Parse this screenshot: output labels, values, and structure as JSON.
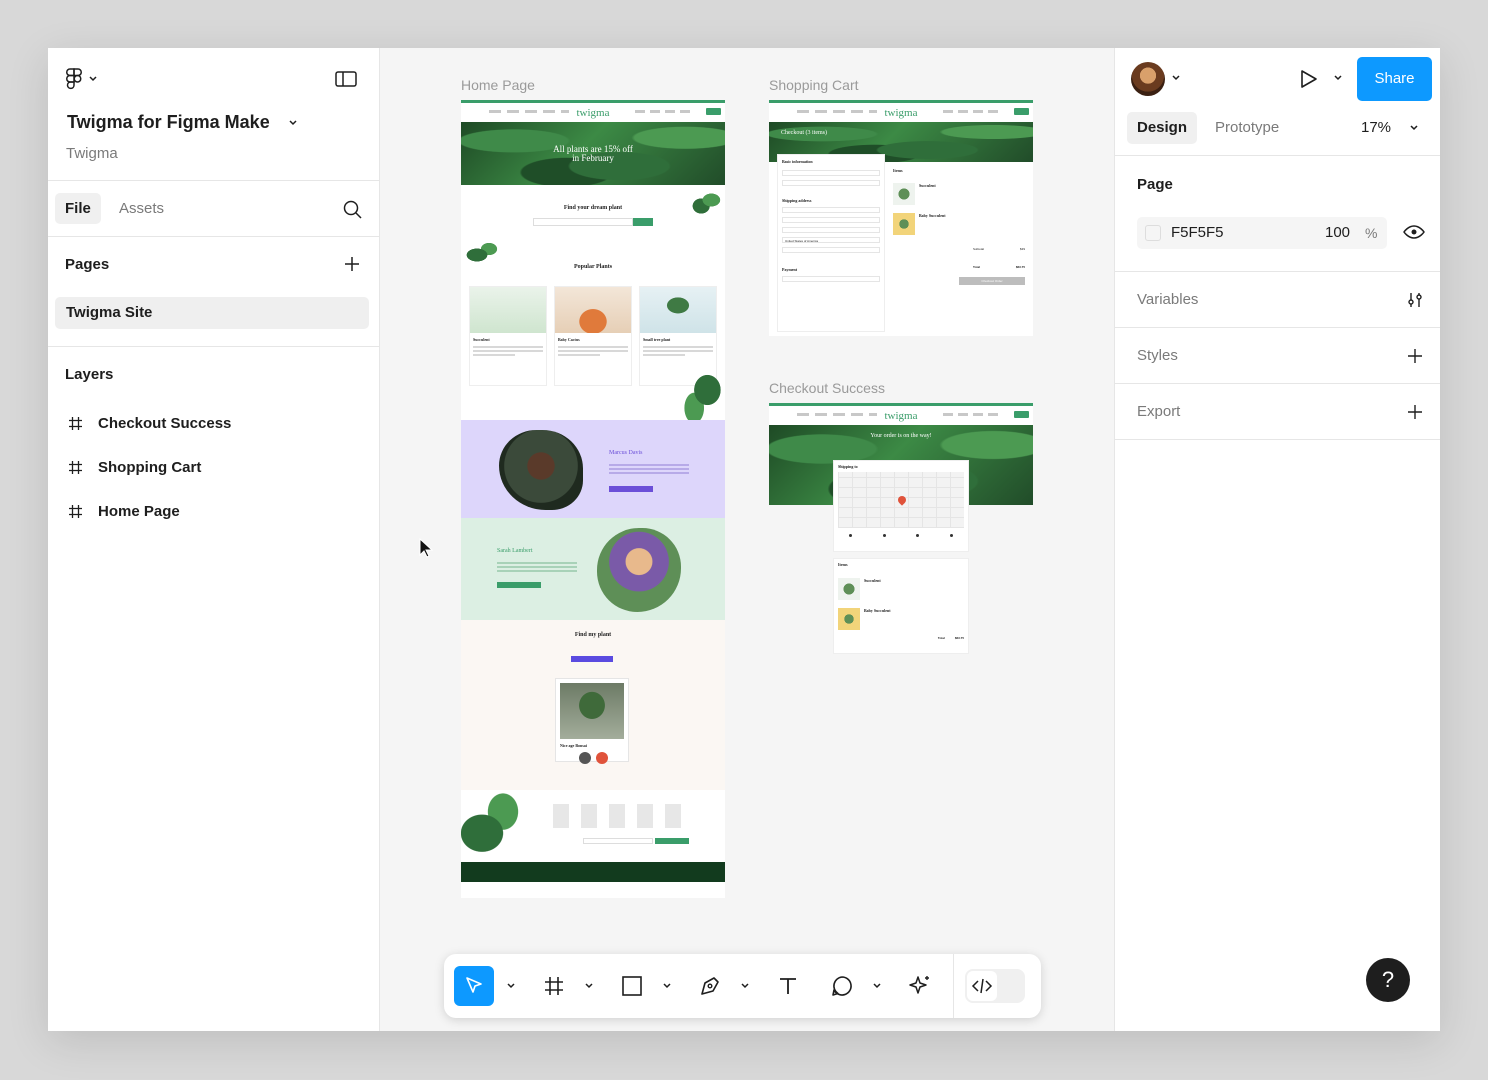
{
  "file": {
    "name": "Twigma for Figma Make",
    "team": "Twigma"
  },
  "left_tabs": {
    "file": "File",
    "assets": "Assets"
  },
  "pages": {
    "title": "Pages",
    "items": [
      "Twigma Site"
    ]
  },
  "layers": {
    "title": "Layers",
    "items": [
      "Checkout Success",
      "Shopping Cart",
      "Home Page"
    ]
  },
  "canvas": {
    "frames": {
      "home": {
        "label": "Home Page",
        "logo": "twigma",
        "hero_text": "All plants are 15% off in February",
        "find_title": "Find your dream plant",
        "popular_title": "Popular Plants",
        "plants": [
          "Succulent",
          "Baby Cactus",
          "Small tree plant"
        ],
        "person1": "Marcus Davis",
        "person2": "Sarah Lambert",
        "find_my_plant": "Find my plant",
        "plant_card": "Nice age Bonsai"
      },
      "cart": {
        "label": "Shopping Cart",
        "logo": "twigma",
        "heading": "Checkout (3 items)",
        "basic_info": "Basic information",
        "shipping": "Shipping address",
        "payment": "Payment",
        "items_header": "Items",
        "item1": "Succulent",
        "item2": "Baby Succulent",
        "country": "United States of America",
        "subtotal_label": "Subtotal",
        "total_label": "Total",
        "subtotal_value": "$39",
        "total_value": "$63.75",
        "button": "Checkout Order"
      },
      "success": {
        "label": "Checkout Success",
        "logo": "twigma",
        "heading": "Your order is on the way!",
        "shipping_to": "Shipping to",
        "items_header": "Items",
        "item1": "Succulent",
        "item2": "Baby Succulent",
        "total_label": "Total",
        "total_value": "$63.75"
      }
    }
  },
  "right": {
    "share": "Share",
    "tabs": {
      "design": "Design",
      "prototype": "Prototype"
    },
    "zoom": "17%",
    "page": {
      "title": "Page",
      "fill_hex": "F5F5F5",
      "opacity": "100",
      "opacity_unit": "%"
    },
    "sections": [
      "Variables",
      "Styles",
      "Export"
    ],
    "help": "?"
  },
  "colors": {
    "accent": "#0d99ff",
    "brand_green": "#3a9d6a",
    "canvas": "#F5F5F5"
  },
  "icons": {
    "toolbar": [
      "move-icon",
      "frame-icon",
      "rectangle-icon",
      "pen-icon",
      "text-icon",
      "comment-icon",
      "ai-sparkle-icon",
      "dev-mode-icon"
    ]
  }
}
